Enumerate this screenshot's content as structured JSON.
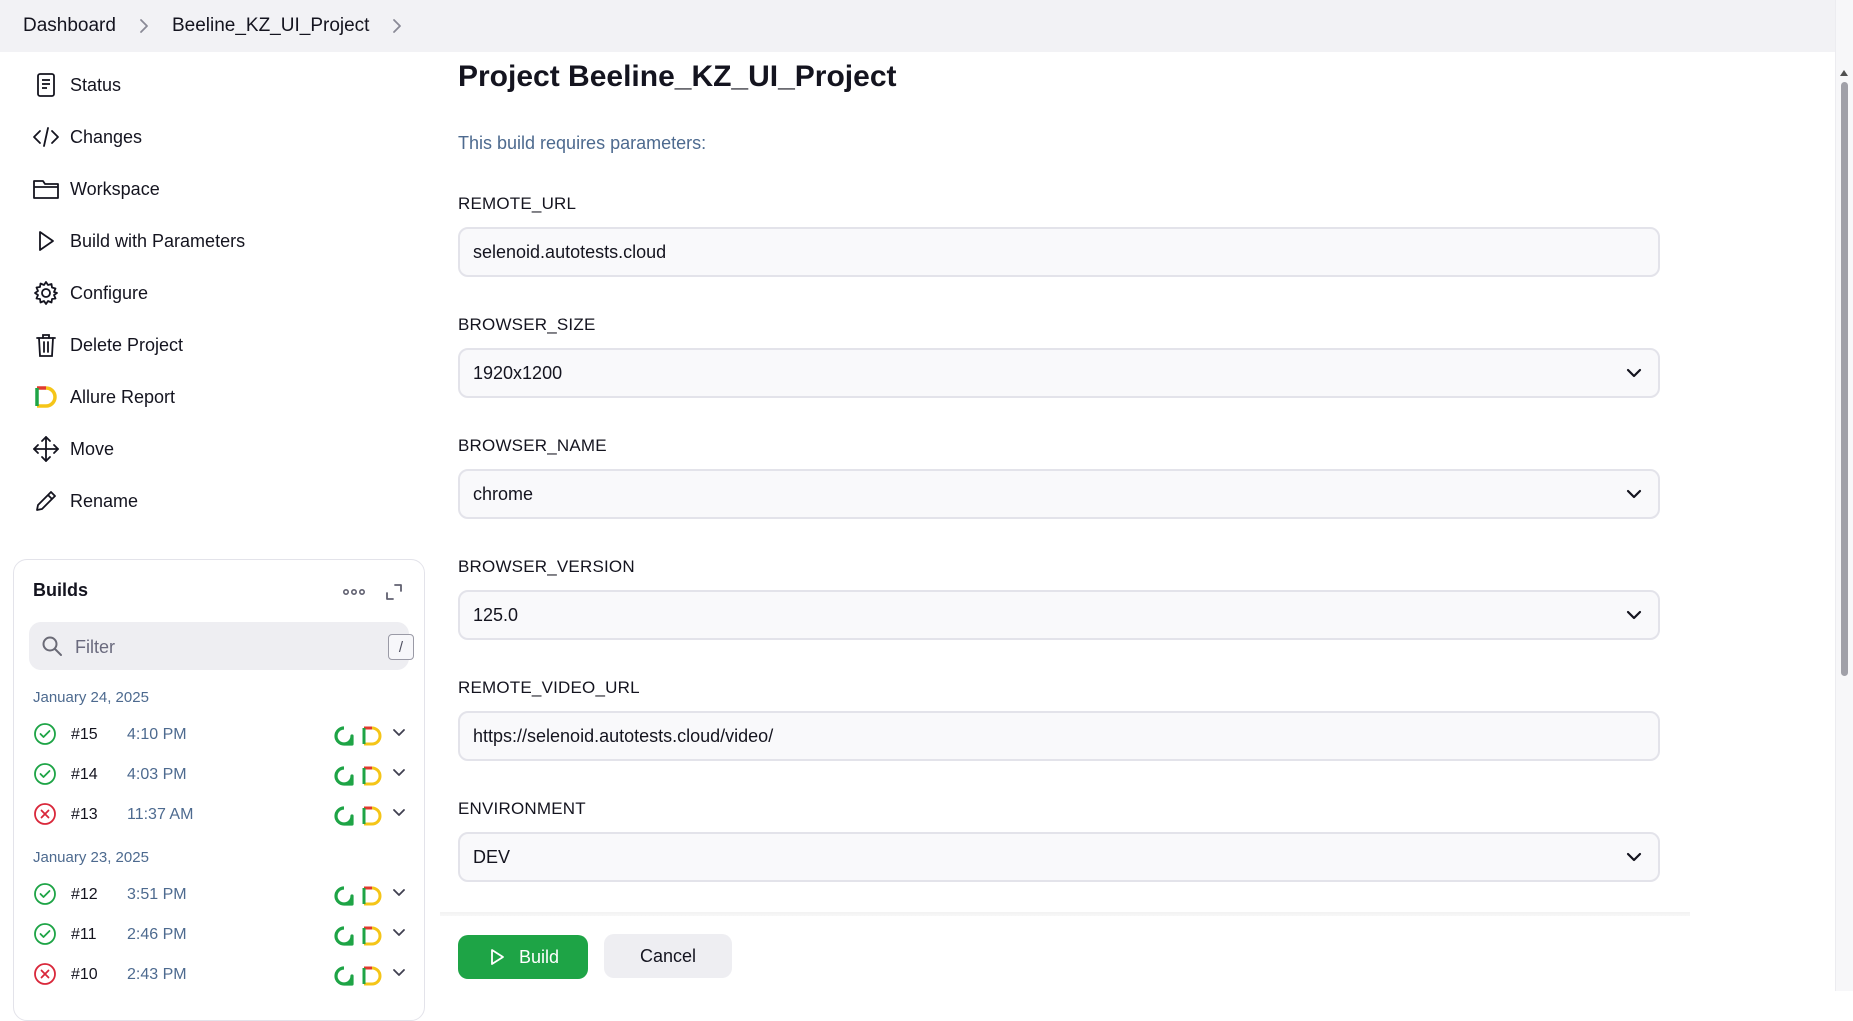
{
  "breadcrumb": {
    "items": [
      "Dashboard",
      "Beeline_KZ_UI_Project"
    ]
  },
  "sidebar": {
    "items": [
      {
        "label": "Status",
        "icon": "document-icon"
      },
      {
        "label": "Changes",
        "icon": "code-icon"
      },
      {
        "label": "Workspace",
        "icon": "folder-icon"
      },
      {
        "label": "Build with Parameters",
        "icon": "play-icon"
      },
      {
        "label": "Configure",
        "icon": "gear-icon"
      },
      {
        "label": "Delete Project",
        "icon": "trash-icon"
      },
      {
        "label": "Allure Report",
        "icon": "allure-icon"
      },
      {
        "label": "Move",
        "icon": "move-icon"
      },
      {
        "label": "Rename",
        "icon": "pencil-icon"
      }
    ]
  },
  "builds": {
    "title": "Builds",
    "filter_placeholder": "Filter",
    "filter_shortcut": "/",
    "groups": [
      {
        "date": "January 24, 2025",
        "rows": [
          {
            "number": "#15",
            "time": "4:10 PM",
            "status": "success"
          },
          {
            "number": "#14",
            "time": "4:03 PM",
            "status": "success"
          },
          {
            "number": "#13",
            "time": "11:37 AM",
            "status": "failed"
          }
        ]
      },
      {
        "date": "January 23, 2025",
        "rows": [
          {
            "number": "#12",
            "time": "3:51 PM",
            "status": "success"
          },
          {
            "number": "#11",
            "time": "2:46 PM",
            "status": "success"
          },
          {
            "number": "#10",
            "time": "2:43 PM",
            "status": "failed"
          }
        ]
      }
    ]
  },
  "main": {
    "title": "Project Beeline_KZ_UI_Project",
    "description": "This build requires parameters:",
    "params": [
      {
        "name": "REMOTE_URL",
        "type": "text",
        "value": "selenoid.autotests.cloud"
      },
      {
        "name": "BROWSER_SIZE",
        "type": "select",
        "value": "1920x1200"
      },
      {
        "name": "BROWSER_NAME",
        "type": "select",
        "value": "chrome"
      },
      {
        "name": "BROWSER_VERSION",
        "type": "select",
        "value": "125.0"
      },
      {
        "name": "REMOTE_VIDEO_URL",
        "type": "text",
        "value": "https://selenoid.autotests.cloud/video/"
      },
      {
        "name": "ENVIRONMENT",
        "type": "select",
        "value": "DEV"
      }
    ],
    "build_button": "Build",
    "cancel_button": "Cancel"
  },
  "colors": {
    "success": "#1ea446",
    "failed": "#d9283b",
    "accent_link": "#4d6a8f",
    "allure_yellow": "#f5c518",
    "allure_red": "#e0392e"
  }
}
